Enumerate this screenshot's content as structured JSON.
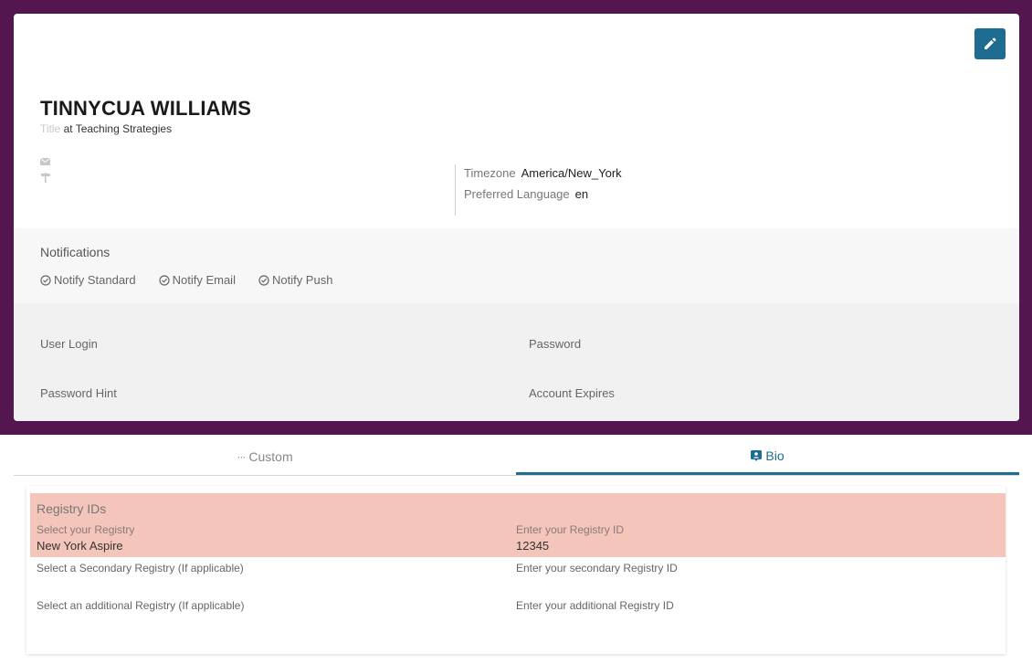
{
  "profile": {
    "name": "TINNYCUA WILLIAMS",
    "title_placeholder": "Title",
    "company": "at Teaching Strategies",
    "timezone_label": "Timezone",
    "timezone_value": "America/New_York",
    "language_label": "Preferred Language",
    "language_value": "en"
  },
  "notifications": {
    "title": "Notifications",
    "items": [
      "Notify Standard",
      "Notify Email",
      "Notify Push"
    ]
  },
  "login": {
    "user_login": "User Login",
    "password": "Password",
    "password_hint": "Password Hint",
    "account_expires": "Account Expires"
  },
  "tabs": [
    {
      "label": "Custom",
      "icon": "ellipsis-icon",
      "active": false
    },
    {
      "label": "Bio",
      "icon": "id-badge-icon",
      "active": true
    }
  ],
  "registry": {
    "title": "Registry IDs",
    "primary_label": "Select your Registry",
    "primary_value": "New York Aspire",
    "primary_id_label": "Enter your Registry ID",
    "primary_id_value": "12345",
    "secondary_label": "Select a Secondary Registry (If applicable)",
    "secondary_id_label": "Enter your secondary Registry ID",
    "additional_label": "Select an additional Registry (If applicable)",
    "additional_id_label": "Enter your additional Registry ID"
  },
  "colors": {
    "header_bg": "#54164f",
    "accent": "#1e6c92",
    "registry_highlight": "#f4c6bb"
  }
}
